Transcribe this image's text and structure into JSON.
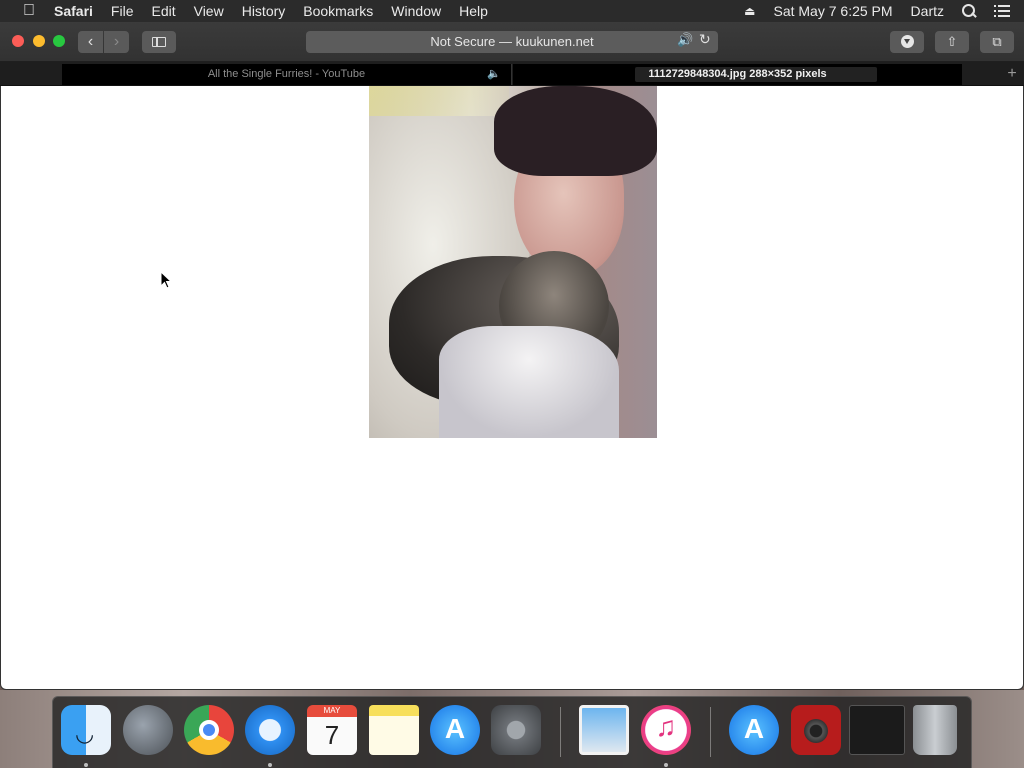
{
  "menubar": {
    "app_name": "Safari",
    "items": [
      "File",
      "Edit",
      "View",
      "History",
      "Bookmarks",
      "Window",
      "Help"
    ],
    "datetime": "Sat May 7  6:25 PM",
    "user": "Dartz"
  },
  "toolbar": {
    "address": "Not Secure — kuukunen.net"
  },
  "tabs": [
    {
      "title": "All the Single Furries! - YouTube",
      "audio": true,
      "active": false
    },
    {
      "title": "1112729848304.jpg 288×352 pixels",
      "active": true
    }
  ],
  "dock": {
    "calendar_month": "MAY",
    "calendar_day": "7"
  },
  "icons": {
    "apple": "apple-logo-icon",
    "eject": "eject-icon",
    "search": "spotlight-search-icon",
    "notifications": "notification-center-icon"
  }
}
